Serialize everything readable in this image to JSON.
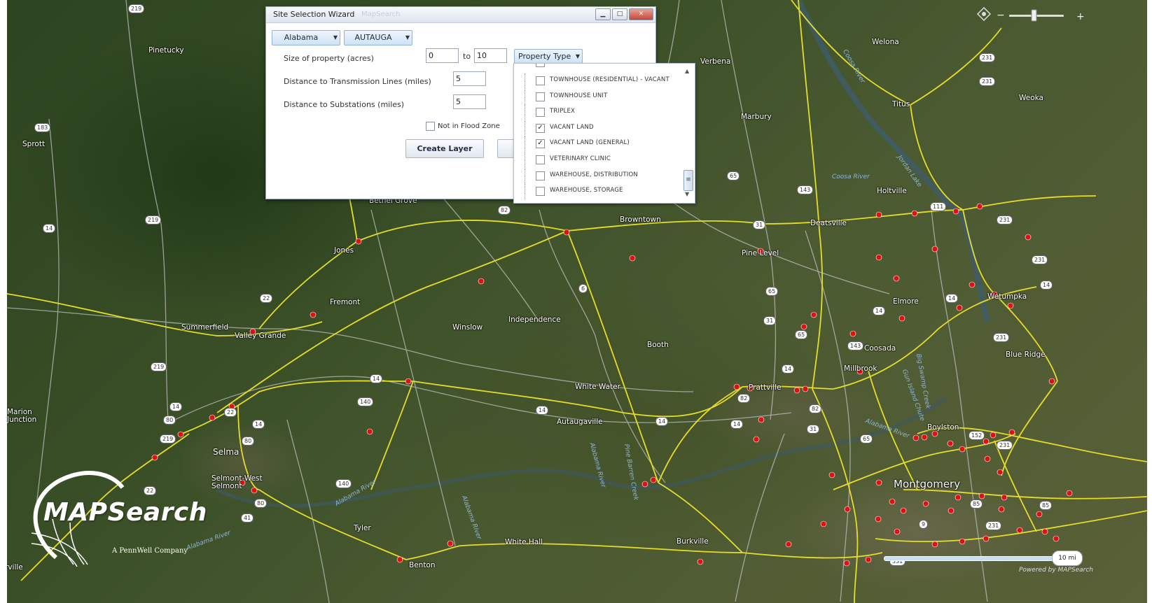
{
  "wizard": {
    "title": "Site Selection Wizard",
    "title_bar_ghost": "MapSearch",
    "state_select": "Alabama",
    "county_select": "AUTAUGA",
    "size_label": "Size of property (acres)",
    "size_from": "0",
    "size_to_label": "to",
    "size_to": "10",
    "property_type_label": "Property Type",
    "transmission_label": "Distance to Transmission Lines (miles)",
    "transmission_value": "5",
    "substation_label": "Distance to Substations (miles)",
    "substation_value": "5",
    "flood_label": "Not in Flood Zone",
    "flood_checked": false,
    "create_layer_button": "Create Layer"
  },
  "property_types": [
    {
      "label": "TOWNHOUSE (RESIDENTIAL) - VACANT",
      "checked": false
    },
    {
      "label": "TOWNHOUSE UNIT",
      "checked": false
    },
    {
      "label": "TRIPLEX",
      "checked": false
    },
    {
      "label": "VACANT LAND",
      "checked": true
    },
    {
      "label": "VACANT LAND (GENERAL)",
      "checked": true
    },
    {
      "label": "VETERINARY CLINIC",
      "checked": false
    },
    {
      "label": "WAREHOUSE, DISTRIBUTION",
      "checked": false
    },
    {
      "label": "WAREHOUSE, STORAGE",
      "checked": false
    }
  ],
  "map": {
    "towns": [
      {
        "name": "Pinetucky"
      },
      {
        "name": "Sprott"
      },
      {
        "name": "Bethel Grove"
      },
      {
        "name": "Jones"
      },
      {
        "name": "Fremont"
      },
      {
        "name": "Summerfield"
      },
      {
        "name": "Valley Grande"
      },
      {
        "name": "Winslow"
      },
      {
        "name": "Independence"
      },
      {
        "name": "Browntown"
      },
      {
        "name": "Verbena"
      },
      {
        "name": "Marbury"
      },
      {
        "name": "Welona"
      },
      {
        "name": "Weoka"
      },
      {
        "name": "Titus"
      },
      {
        "name": "Holtville"
      },
      {
        "name": "Deatsville"
      },
      {
        "name": "Pine Level"
      },
      {
        "name": "Elmore"
      },
      {
        "name": "Wetumpka"
      },
      {
        "name": "Coosada"
      },
      {
        "name": "Millbrook"
      },
      {
        "name": "Blue Ridge"
      },
      {
        "name": "Booth"
      },
      {
        "name": "White Water"
      },
      {
        "name": "Prattville"
      },
      {
        "name": "Autaugaville"
      },
      {
        "name": "Marion Junction"
      },
      {
        "name": "Selma"
      },
      {
        "name": "Selmont-West Selmont"
      },
      {
        "name": "Tyler"
      },
      {
        "name": "White Hall"
      },
      {
        "name": "Burkville"
      },
      {
        "name": "Benton"
      },
      {
        "name": "Montgomery"
      },
      {
        "name": "Boylston"
      },
      {
        "name": "rville"
      }
    ],
    "water_labels": [
      "Coosa River",
      "Coosa River",
      "Jordan Lake",
      "Alabama River",
      "Alabama River",
      "Alabama River",
      "Alabama River",
      "Pine Barren Creek",
      "Big Swamp Creek",
      "Gun Island Chute",
      "Alabama River"
    ],
    "road_shields": [
      "219",
      "183",
      "14",
      "219",
      "22",
      "219",
      "14",
      "80",
      "219",
      "80",
      "22",
      "14",
      "140",
      "140",
      "14",
      "41",
      "80",
      "22",
      "14",
      "82",
      "6",
      "14",
      "31",
      "65",
      "31",
      "65",
      "143",
      "14",
      "82",
      "31",
      "14",
      "65",
      "231",
      "231",
      "231",
      "14",
      "152",
      "231",
      "85",
      "9",
      "85",
      "331",
      "14",
      "111",
      "14",
      "65",
      "143",
      "231",
      "231",
      "231",
      "82"
    ]
  },
  "logo": {
    "text": "MAPSearch",
    "sub": "A PennWell Company"
  },
  "scale": {
    "label": "10 mi"
  },
  "copyright": "Powered by MAPSearch",
  "colors": {
    "power_line": "#e6dd2a",
    "substation": "#e01010",
    "dialog_accent": "#cfe3f7"
  }
}
